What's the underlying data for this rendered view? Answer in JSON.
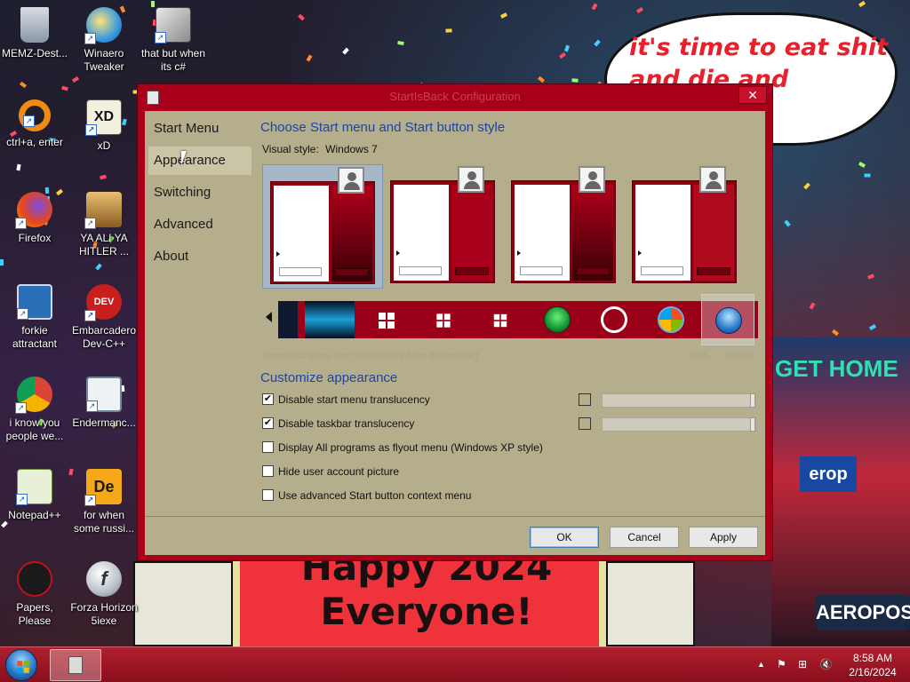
{
  "desktop": {
    "bubble_text": "it's time to eat shit and die and celebrate",
    "sign_text": "Happy 2024 Everyone!",
    "billboard_text_1": "AEROPOS",
    "billboard_text_2": "erop",
    "billboard_text_3": "GET HOME",
    "icons": [
      {
        "label": "MEMZ-Dest..."
      },
      {
        "label": "Winaero Tweaker"
      },
      {
        "label": "that but when its c#"
      },
      {
        "label": "ctrl+a, enter"
      },
      {
        "label": "xD"
      },
      {
        "label": "Firefox"
      },
      {
        "label": "YA ALI YA HITLER ..."
      },
      {
        "label": "forkie attractant"
      },
      {
        "label": "Embarcadero Dev-C++"
      },
      {
        "label": "i know you people we..."
      },
      {
        "label": "Endermanc..."
      },
      {
        "label": "Notepad++"
      },
      {
        "label": "for when some russi..."
      },
      {
        "label": "Papers, Please"
      },
      {
        "label": "Forza Horizon 5iexe"
      }
    ]
  },
  "window": {
    "title": "StartIsBack Configuration",
    "close_glyph": "✕",
    "nav": [
      {
        "label": "Start Menu"
      },
      {
        "label": "Appearance"
      },
      {
        "label": "Switching"
      },
      {
        "label": "Advanced"
      },
      {
        "label": "About"
      }
    ],
    "selected_nav": "Appearance",
    "section1_title": "Choose Start menu and Start button style",
    "visual_style_label": "Visual style:",
    "visual_style_value": "Windows 7",
    "download_link": "Download more start button orbs from deviantART",
    "add_label": "Add...",
    "delete_label": "Delete",
    "section2_title": "Customize appearance",
    "options": [
      {
        "label": "Disable start menu translucency",
        "checked": true
      },
      {
        "label": "Disable taskbar translucency",
        "checked": true
      },
      {
        "label": "Display All programs as flyout menu (Windows XP style)",
        "checked": false
      },
      {
        "label": "Hide user account picture",
        "checked": false
      },
      {
        "label": "Use advanced Start button context menu",
        "checked": false
      }
    ],
    "buttons": {
      "ok": "OK",
      "cancel": "Cancel",
      "apply": "Apply"
    },
    "checkmark_glyph": "✔"
  },
  "taskbar": {
    "time": "8:58 AM",
    "date": "2/16/2024",
    "tray_up_glyph": "▲",
    "tray_flag_glyph": "⚑",
    "tray_network_glyph": "⊞",
    "tray_volume_glyph": "🔇"
  },
  "colors": {
    "window_frame": "#a8001a",
    "client_bg": "#b5ae8c",
    "link_blue": "#1a44a8",
    "taskbar": "#a01828"
  }
}
